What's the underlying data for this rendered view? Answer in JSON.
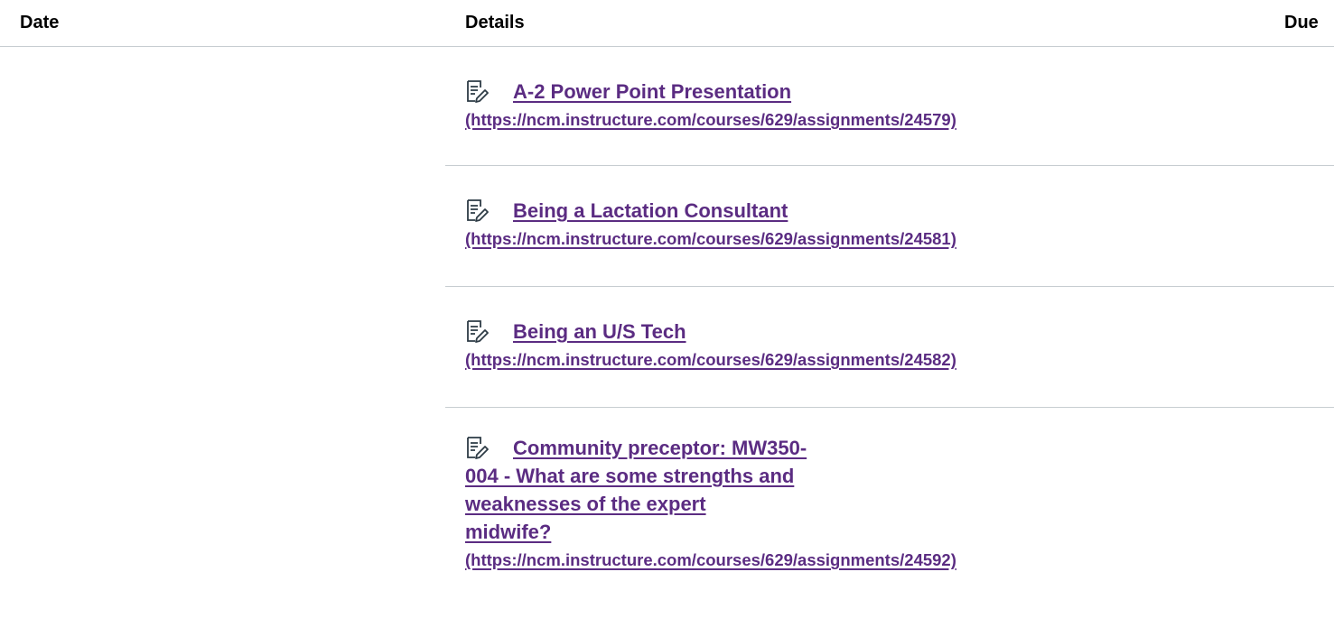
{
  "table": {
    "headers": {
      "date": "Date",
      "details": "Details",
      "due": "Due"
    },
    "rows": [
      {
        "icon": "assignment-icon",
        "title": "A-2 Power Point Presentation",
        "url": "(https://ncm.instructure.com/courses/629/assignments/24579)"
      },
      {
        "icon": "assignment-icon",
        "title": "Being a Lactation Consultant",
        "url": "(https://ncm.instructure.com/courses/629/assignments/24581)"
      },
      {
        "icon": "assignment-icon",
        "title": "Being an U/S Tech",
        "url": "(https://ncm.instructure.com/courses/629/assignments/24582)"
      },
      {
        "icon": "assignment-icon",
        "title_lines": [
          "Community preceptor: MW350-",
          "004 - What are some strengths and",
          "weaknesses of the expert",
          "midwife?"
        ],
        "url": "(https://ncm.instructure.com/courses/629/assignments/24592)"
      }
    ]
  },
  "colors": {
    "link": "#5b2c82",
    "header_text": "#000000",
    "divider": "#c7cdd1"
  }
}
